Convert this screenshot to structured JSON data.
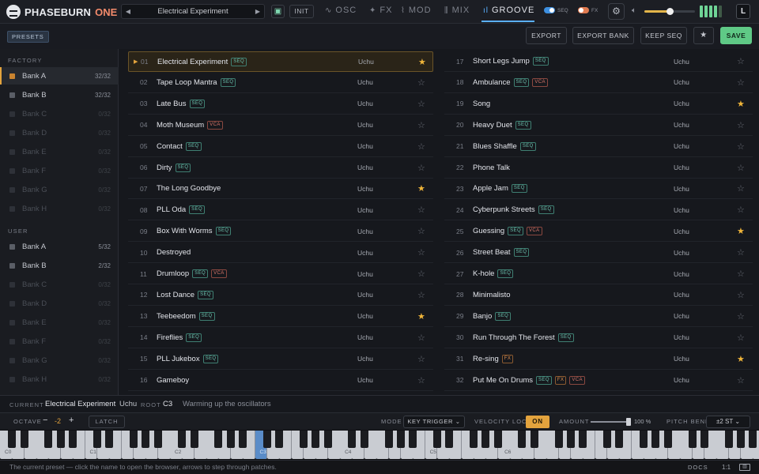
{
  "app": {
    "name_main": "PHASEBURN",
    "name_accent": "ONE"
  },
  "nav": {
    "prev_icon": "◀",
    "next_icon": "▶",
    "preset_name": "Electrical Experiment",
    "save_icon": "floppy-icon",
    "init_label": "INIT"
  },
  "tabs": [
    {
      "label": "OSC",
      "icon": "∿"
    },
    {
      "label": "FX",
      "icon": "✦"
    },
    {
      "label": "MOD",
      "icon": "⌇"
    },
    {
      "label": "MIX",
      "icon": "⫼"
    },
    {
      "label": "GROOVE",
      "icon": "ıl"
    }
  ],
  "toggles": {
    "seq_label": "SEQ",
    "fx_label": "FX"
  },
  "volume": {
    "level": 0.5
  },
  "meter": {
    "lit": 4,
    "total": 5
  },
  "l_button": "L",
  "colors": {
    "accent": "#5ab0ff",
    "star": "#f0b53a",
    "save": "#5fc986",
    "bank_active": "#e3a33d"
  },
  "subbar": {
    "presets_badge": "PRESETS",
    "export": "EXPORT",
    "export_bank": "EXPORT BANK",
    "keep_seq": "KEEP SEQ",
    "star": "★",
    "save": "SAVE"
  },
  "sidebar": {
    "factory_label": "FACTORY",
    "factory": [
      {
        "label": "Bank A",
        "count": "32/32",
        "active": true,
        "enabled": true
      },
      {
        "label": "Bank B",
        "count": "32/32",
        "active": false,
        "enabled": true
      },
      {
        "label": "Bank C",
        "count": "0/32",
        "enabled": false
      },
      {
        "label": "Bank D",
        "count": "0/32",
        "enabled": false
      },
      {
        "label": "Bank E",
        "count": "0/32",
        "enabled": false
      },
      {
        "label": "Bank F",
        "count": "0/32",
        "enabled": false
      },
      {
        "label": "Bank G",
        "count": "0/32",
        "enabled": false
      },
      {
        "label": "Bank H",
        "count": "0/32",
        "enabled": false
      }
    ],
    "user_label": "USER",
    "user": [
      {
        "label": "Bank A",
        "count": "5/32",
        "enabled": true
      },
      {
        "label": "Bank B",
        "count": "2/32",
        "enabled": true
      },
      {
        "label": "Bank C",
        "count": "0/32",
        "enabled": false
      },
      {
        "label": "Bank D",
        "count": "0/32",
        "enabled": false
      },
      {
        "label": "Bank E",
        "count": "0/32",
        "enabled": false
      },
      {
        "label": "Bank F",
        "count": "0/32",
        "enabled": false
      },
      {
        "label": "Bank G",
        "count": "0/32",
        "enabled": false
      },
      {
        "label": "Bank H",
        "count": "0/32",
        "enabled": false
      }
    ]
  },
  "presets": [
    {
      "num": "01",
      "name": "Electrical Experiment",
      "tags": [
        "SEQ"
      ],
      "author": "Uchu",
      "fav": true,
      "selected": true
    },
    {
      "num": "02",
      "name": "Tape Loop Mantra",
      "tags": [
        "SEQ"
      ],
      "author": "Uchu",
      "fav": false
    },
    {
      "num": "03",
      "name": "Late Bus",
      "tags": [
        "SEQ"
      ],
      "author": "Uchu",
      "fav": false
    },
    {
      "num": "04",
      "name": "Moth Museum",
      "tags": [
        "VCA"
      ],
      "author": "Uchu",
      "fav": false
    },
    {
      "num": "05",
      "name": "Contact",
      "tags": [
        "SEQ"
      ],
      "author": "Uchu",
      "fav": false
    },
    {
      "num": "06",
      "name": "Dirty",
      "tags": [
        "SEQ"
      ],
      "author": "Uchu",
      "fav": false
    },
    {
      "num": "07",
      "name": "The Long Goodbye",
      "tags": [],
      "author": "Uchu",
      "fav": true
    },
    {
      "num": "08",
      "name": "PLL Oda",
      "tags": [
        "SEQ"
      ],
      "author": "Uchu",
      "fav": false
    },
    {
      "num": "09",
      "name": "Box With Worms",
      "tags": [
        "SEQ"
      ],
      "author": "Uchu",
      "fav": false
    },
    {
      "num": "10",
      "name": "Destroyed",
      "tags": [],
      "author": "Uchu",
      "fav": false
    },
    {
      "num": "11",
      "name": "Drumloop",
      "tags": [
        "SEQ",
        "VCA"
      ],
      "author": "Uchu",
      "fav": false
    },
    {
      "num": "12",
      "name": "Lost Dance",
      "tags": [
        "SEQ"
      ],
      "author": "Uchu",
      "fav": false
    },
    {
      "num": "13",
      "name": "Teebeedom",
      "tags": [
        "SEQ"
      ],
      "author": "Uchu",
      "fav": true
    },
    {
      "num": "14",
      "name": "Fireflies",
      "tags": [
        "SEQ"
      ],
      "author": "Uchu",
      "fav": false
    },
    {
      "num": "15",
      "name": "PLL Jukebox",
      "tags": [
        "SEQ"
      ],
      "author": "Uchu",
      "fav": false
    },
    {
      "num": "16",
      "name": "Gameboy",
      "tags": [],
      "author": "Uchu",
      "fav": false
    },
    {
      "num": "17",
      "name": "Short Legs Jump",
      "tags": [
        "SEQ"
      ],
      "author": "Uchu",
      "fav": false
    },
    {
      "num": "18",
      "name": "Ambulance",
      "tags": [
        "SEQ",
        "VCA"
      ],
      "author": "Uchu",
      "fav": false
    },
    {
      "num": "19",
      "name": "Song",
      "tags": [],
      "author": "Uchu",
      "fav": true
    },
    {
      "num": "20",
      "name": "Heavy Duet",
      "tags": [
        "SEQ"
      ],
      "author": "Uchu",
      "fav": false
    },
    {
      "num": "21",
      "name": "Blues Shaffle",
      "tags": [
        "SEQ"
      ],
      "author": "Uchu",
      "fav": false
    },
    {
      "num": "22",
      "name": "Phone Talk",
      "tags": [],
      "author": "Uchu",
      "fav": false
    },
    {
      "num": "23",
      "name": "Apple Jam",
      "tags": [
        "SEQ"
      ],
      "author": "Uchu",
      "fav": false
    },
    {
      "num": "24",
      "name": "Cyberpunk Streets",
      "tags": [
        "SEQ"
      ],
      "author": "Uchu",
      "fav": false
    },
    {
      "num": "25",
      "name": "Guessing",
      "tags": [
        "SEQ",
        "VCA"
      ],
      "author": "Uchu",
      "fav": true
    },
    {
      "num": "26",
      "name": "Street Beat",
      "tags": [
        "SEQ"
      ],
      "author": "Uchu",
      "fav": false
    },
    {
      "num": "27",
      "name": "K-hole",
      "tags": [
        "SEQ"
      ],
      "author": "Uchu",
      "fav": false
    },
    {
      "num": "28",
      "name": "Minimalisto",
      "tags": [],
      "author": "Uchu",
      "fav": false
    },
    {
      "num": "29",
      "name": "Banjo",
      "tags": [
        "SEQ"
      ],
      "author": "Uchu",
      "fav": false
    },
    {
      "num": "30",
      "name": "Run Through The Forest",
      "tags": [
        "SEQ"
      ],
      "author": "Uchu",
      "fav": false
    },
    {
      "num": "31",
      "name": "Re-sing",
      "tags": [
        "FX"
      ],
      "author": "Uchu",
      "fav": true
    },
    {
      "num": "32",
      "name": "Put Me On Drums",
      "tags": [
        "SEQ",
        "FX",
        "VCA"
      ],
      "author": "Uchu",
      "fav": false
    }
  ],
  "status": {
    "current_label": "CURRENT",
    "current_name": "Electrical Experiment",
    "current_author": "Uchu",
    "root_label": "ROOT",
    "root_value": "C3",
    "message": "Warming up the oscillators"
  },
  "controls": {
    "octave_label": "OCTAVE",
    "minus": "−",
    "octave_value": "-2",
    "plus": "+",
    "latch": "LATCH",
    "mode_label": "MODE",
    "mode_value": "KEY TRIGGER ⌄",
    "vel_label": "VELOCITY LOCK",
    "vel_value": "ON",
    "amount_label": "AMOUNT",
    "amount_value": "100 %",
    "amount_level": 1.0,
    "pb_label": "PITCH BEND",
    "pb_value": "±2 ST ⌄"
  },
  "keyboard": {
    "octave_labels": [
      "C0",
      "C1",
      "C2",
      "C3",
      "C4",
      "C5",
      "C6"
    ],
    "highlight_label": "C3"
  },
  "footer": {
    "hint": "The current preset — click the name to open the browser, arrows to step through patches.",
    "docs": "DOCS",
    "ratio": "1:1",
    "kb_icon": "keyboard-icon"
  }
}
